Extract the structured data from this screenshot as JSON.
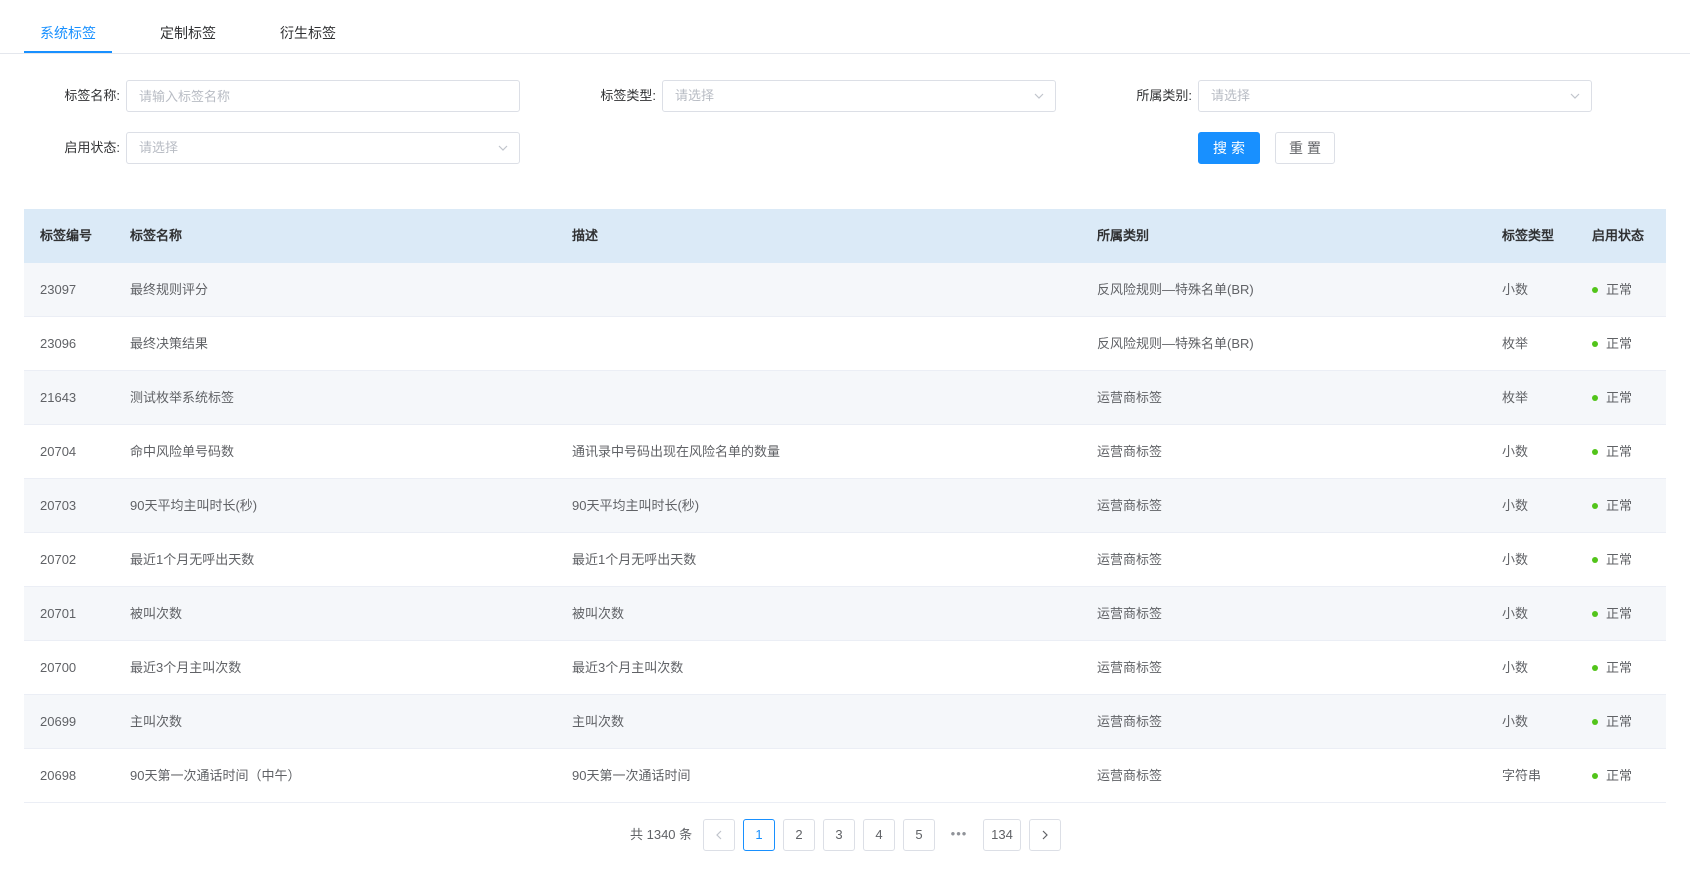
{
  "tabs": [
    {
      "label": "系统标签",
      "active": true
    },
    {
      "label": "定制标签",
      "active": false
    },
    {
      "label": "衍生标签",
      "active": false
    }
  ],
  "filters": {
    "tag_name": {
      "label": "标签名称:",
      "placeholder": "请输入标签名称",
      "value": ""
    },
    "tag_type": {
      "label": "标签类型:",
      "placeholder": "请选择"
    },
    "category": {
      "label": "所属类别:",
      "placeholder": "请选择"
    },
    "status": {
      "label": "启用状态:",
      "placeholder": "请选择"
    },
    "search_label": "搜索",
    "reset_label": "重置"
  },
  "table": {
    "columns": [
      "标签编号",
      "标签名称",
      "描述",
      "所属类别",
      "标签类型",
      "启用状态"
    ],
    "rows": [
      {
        "id": "23097",
        "name": "最终规则评分",
        "desc": "",
        "category": "反风险规则—特殊名单(BR)",
        "type": "小数",
        "status": "正常"
      },
      {
        "id": "23096",
        "name": "最终决策结果",
        "desc": "",
        "category": "反风险规则—特殊名单(BR)",
        "type": "枚举",
        "status": "正常"
      },
      {
        "id": "21643",
        "name": "测试枚举系统标签",
        "desc": "",
        "category": "运营商标签",
        "type": "枚举",
        "status": "正常"
      },
      {
        "id": "20704",
        "name": "命中风险单号码数",
        "desc": "通讯录中号码出现在风险名单的数量",
        "category": "运营商标签",
        "type": "小数",
        "status": "正常"
      },
      {
        "id": "20703",
        "name": "90天平均主叫时长(秒)",
        "desc": "90天平均主叫时长(秒)",
        "category": "运营商标签",
        "type": "小数",
        "status": "正常"
      },
      {
        "id": "20702",
        "name": "最近1个月无呼出天数",
        "desc": "最近1个月无呼出天数",
        "category": "运营商标签",
        "type": "小数",
        "status": "正常"
      },
      {
        "id": "20701",
        "name": "被叫次数",
        "desc": "被叫次数",
        "category": "运营商标签",
        "type": "小数",
        "status": "正常"
      },
      {
        "id": "20700",
        "name": "最近3个月主叫次数",
        "desc": "最近3个月主叫次数",
        "category": "运营商标签",
        "type": "小数",
        "status": "正常"
      },
      {
        "id": "20699",
        "name": "主叫次数",
        "desc": "主叫次数",
        "category": "运营商标签",
        "type": "小数",
        "status": "正常"
      },
      {
        "id": "20698",
        "name": "90天第一次通话时间（中午）",
        "desc": "90天第一次通话时间",
        "category": "运营商标签",
        "type": "字符串",
        "status": "正常"
      }
    ]
  },
  "pagination": {
    "total_text": "共 1340 条",
    "pages": [
      "1",
      "2",
      "3",
      "4",
      "5"
    ],
    "ellipsis": "•••",
    "last_page": "134",
    "current": "1",
    "prev_icon": "chevron-left-icon",
    "next_icon": "chevron-right-icon"
  },
  "colors": {
    "accent": "#1890ff",
    "header_bg": "#dbeaf7",
    "status_ok": "#52c41a"
  }
}
